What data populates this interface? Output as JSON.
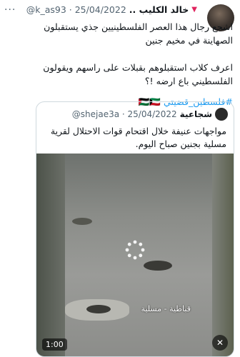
{
  "tweet": {
    "author_name": "خالد الكليب ..",
    "author_flag": "▼",
    "handle_date": "@k_as93 · 25/04/2022",
    "more_label": "···",
    "lines": [
      "اشجع رجال هذا العصر الفلسطينيين جذي يستقبلون",
      "الصهاينة في مخيم جنين"
    ],
    "lines2": [
      "اعرف كلاب استقبلوهم بقبلات على راسهم ويقولون",
      "الفلسطيني باع ارضه !؟"
    ],
    "hashtag": "#فلسطين_قضيتي 🇵🇸🇰🇼"
  },
  "quote": {
    "author_name": "شجاعية",
    "handle_date": "@shejae3a · 25/04/2022",
    "lines": [
      "مواجهات عنيفة خلال اقتحام قوات الاحتلال لقرية",
      "مسلية بجنين صباح اليوم."
    ],
    "video": {
      "watermark": "قباطية - مسلية",
      "duration": "1:00",
      "mute_icon": "speaker-mute-icon",
      "loading_icon": "spinner-icon"
    }
  }
}
